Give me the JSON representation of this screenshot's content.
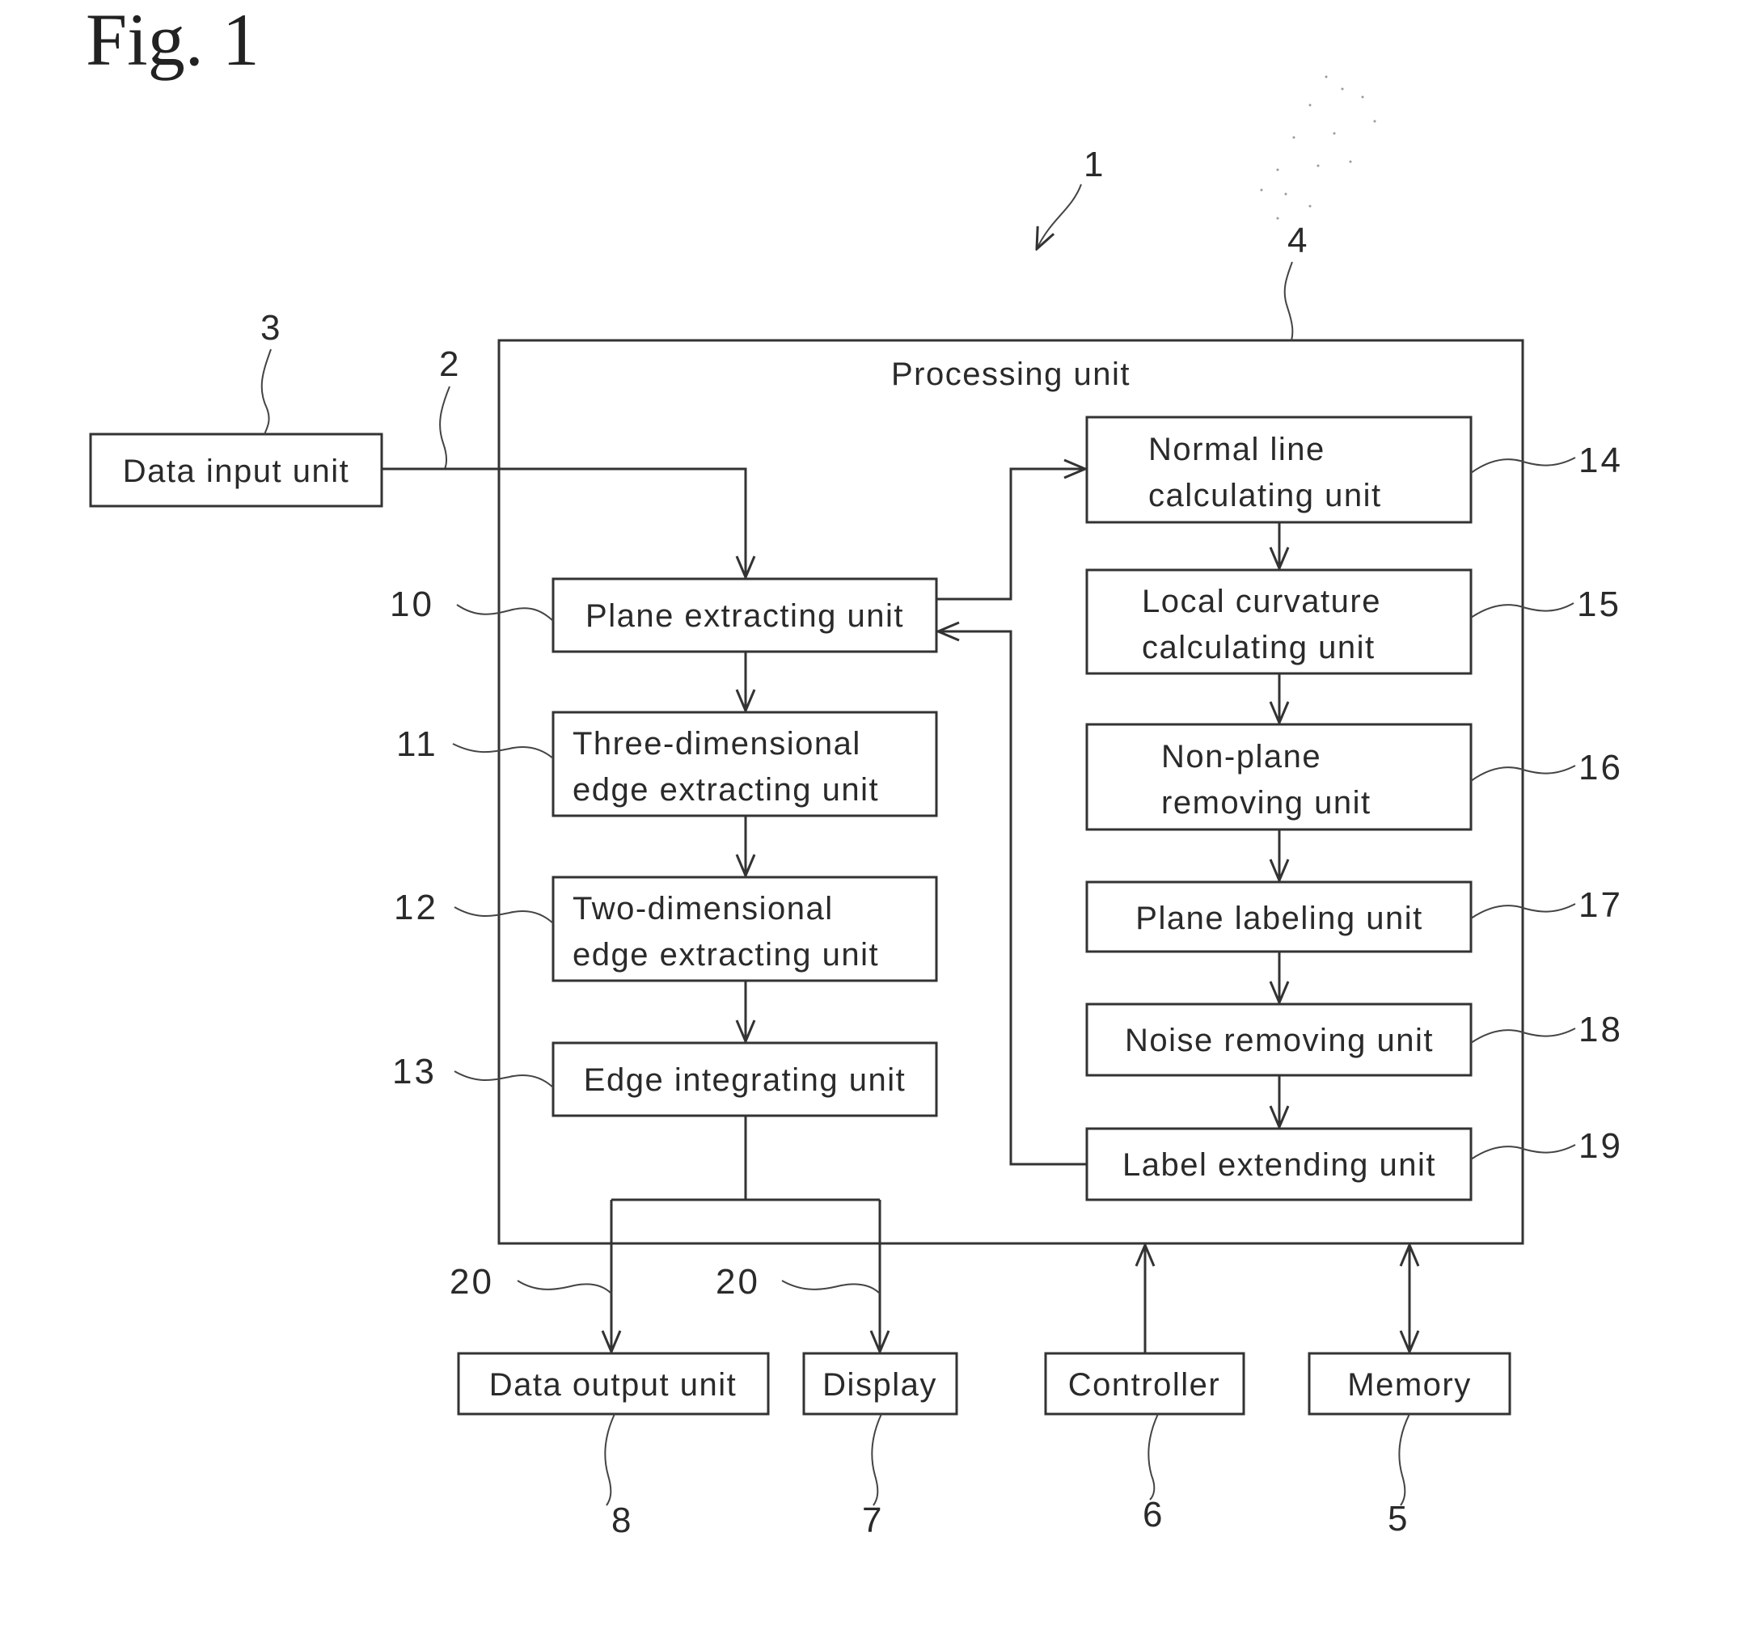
{
  "figure": {
    "title": "Fig. 1",
    "system_ref": "1",
    "processing_unit": {
      "label": "Processing unit",
      "ref": "4"
    }
  },
  "blocks": {
    "data_input": {
      "label": [
        "Data input unit"
      ],
      "ref": "3"
    },
    "plane_extracting": {
      "label": [
        "Plane extracting unit"
      ],
      "ref": "10"
    },
    "three_dim_edge": {
      "label": [
        "Three-dimensional",
        "edge extracting unit"
      ],
      "ref": "11"
    },
    "two_dim_edge": {
      "label": [
        "Two-dimensional",
        "edge extracting unit"
      ],
      "ref": "12"
    },
    "edge_integrating": {
      "label": [
        "Edge integrating unit"
      ],
      "ref": "13"
    },
    "normal_line": {
      "label": [
        "Normal line",
        "calculating unit"
      ],
      "ref": "14"
    },
    "local_curvature": {
      "label": [
        "Local curvature",
        "calculating unit"
      ],
      "ref": "15"
    },
    "non_plane": {
      "label": [
        "Non-plane",
        "removing unit"
      ],
      "ref": "16"
    },
    "plane_labeling": {
      "label": [
        "Plane labeling unit"
      ],
      "ref": "17"
    },
    "noise_removing": {
      "label": [
        "Noise removing unit"
      ],
      "ref": "18"
    },
    "label_extending": {
      "label": [
        "Label extending unit"
      ],
      "ref": "19"
    },
    "data_output": {
      "label": [
        "Data output unit"
      ],
      "ref": "8"
    },
    "display": {
      "label": [
        "Display"
      ],
      "ref": "7"
    },
    "controller": {
      "label": [
        "Controller"
      ],
      "ref": "6"
    },
    "memory": {
      "label": [
        "Memory"
      ],
      "ref": "5"
    }
  },
  "connections": {
    "input_line_ref": "2",
    "output_line_refs": [
      "20",
      "20"
    ]
  }
}
